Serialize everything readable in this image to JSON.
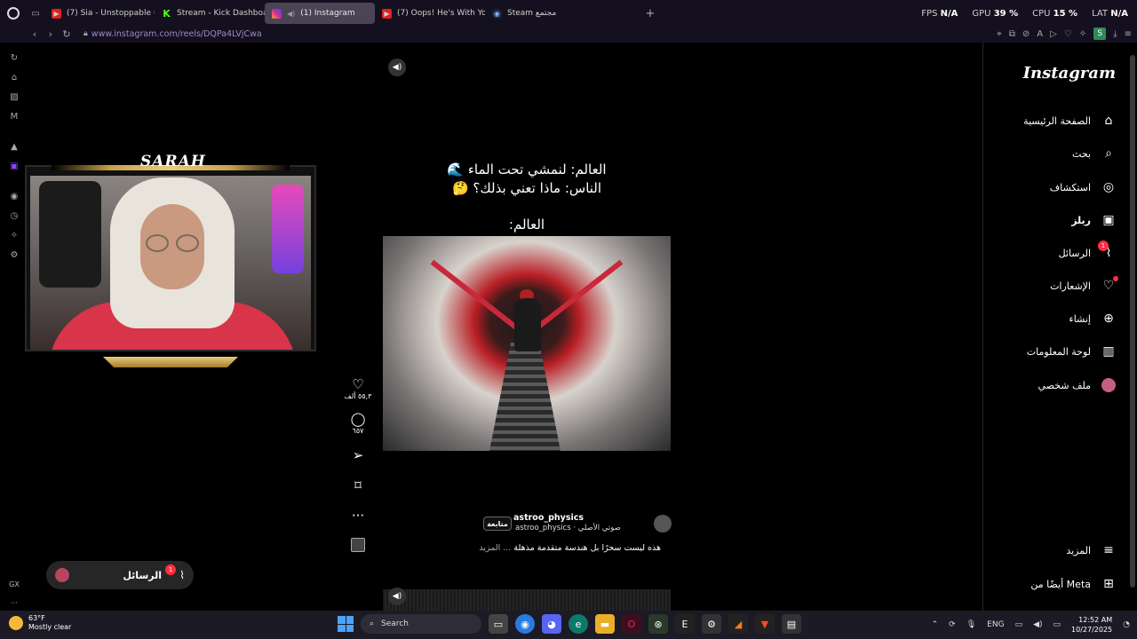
{
  "browser": {
    "tabs": [
      {
        "title": "(7) Sia - Unstoppable (Ly",
        "favicon": "youtube-icon"
      },
      {
        "title": "Stream - Kick Dashboard",
        "favicon": "kick-icon"
      },
      {
        "title": "(1) Instagram",
        "favicon": "instagram-icon",
        "active": true,
        "muted": true
      },
      {
        "title": "(7) Oops! He's With You?",
        "favicon": "youtube-icon"
      },
      {
        "title": "Steam مجتمع",
        "favicon": "steam-icon"
      }
    ],
    "url": "www.instagram.com/reels/DQPa4LVjCwa",
    "profile_initial": "S"
  },
  "stats": {
    "fps_label": "FPS",
    "fps_value": "N/A",
    "gpu_label": "GPU",
    "gpu_value": "39 %",
    "cpu_label": "CPU",
    "cpu_value": "15 %",
    "lat_label": "LAT",
    "lat_value": "N/A"
  },
  "webcam": {
    "logo": "SARAH"
  },
  "reel": {
    "line1": "العالم: لنمشي تحت الماء 🌊",
    "line2": "الناس: ماذا تعني بذلك؟ 🤔",
    "line3": "العالم:",
    "likes": "٥٥,٣ ألف",
    "comments": "٦٥٧",
    "author": "astroo_physics",
    "audio": "صوتي الأصلي · astroo_physics",
    "follow": "متابعة",
    "caption": "هذه ليست سحرًا بل هندسة متقدمة مذهلة",
    "more": "... المزيد"
  },
  "messages_pill": {
    "label": "الرسائل",
    "badge": "1"
  },
  "instagram_nav": {
    "logo": "Instagram",
    "items": [
      {
        "label": "الصفحة الرئيسية",
        "icon": "home-icon"
      },
      {
        "label": "بحث",
        "icon": "search-icon"
      },
      {
        "label": "استكشاف",
        "icon": "compass-icon"
      },
      {
        "label": "ريلز",
        "icon": "reels-icon",
        "active": true
      },
      {
        "label": "الرسائل",
        "icon": "messenger-icon",
        "badge": "1"
      },
      {
        "label": "الإشعارات",
        "icon": "heart-icon"
      },
      {
        "label": "إنشاء",
        "icon": "plus-square-icon"
      },
      {
        "label": "لوحة المعلومات",
        "icon": "dashboard-icon"
      },
      {
        "label": "ملف شخصي",
        "icon": "avatar"
      }
    ],
    "more": "المزيد",
    "meta": "أيضًا من Meta"
  },
  "taskbar": {
    "temp": "63°F",
    "weather": "Mostly clear",
    "search": "Search",
    "lang": "ENG",
    "time": "12:52 AM",
    "date": "10/27/2025"
  },
  "colors": {
    "accent_url": "#9b8bc7",
    "notification": "#ff3040",
    "kick": "#53fc18"
  }
}
